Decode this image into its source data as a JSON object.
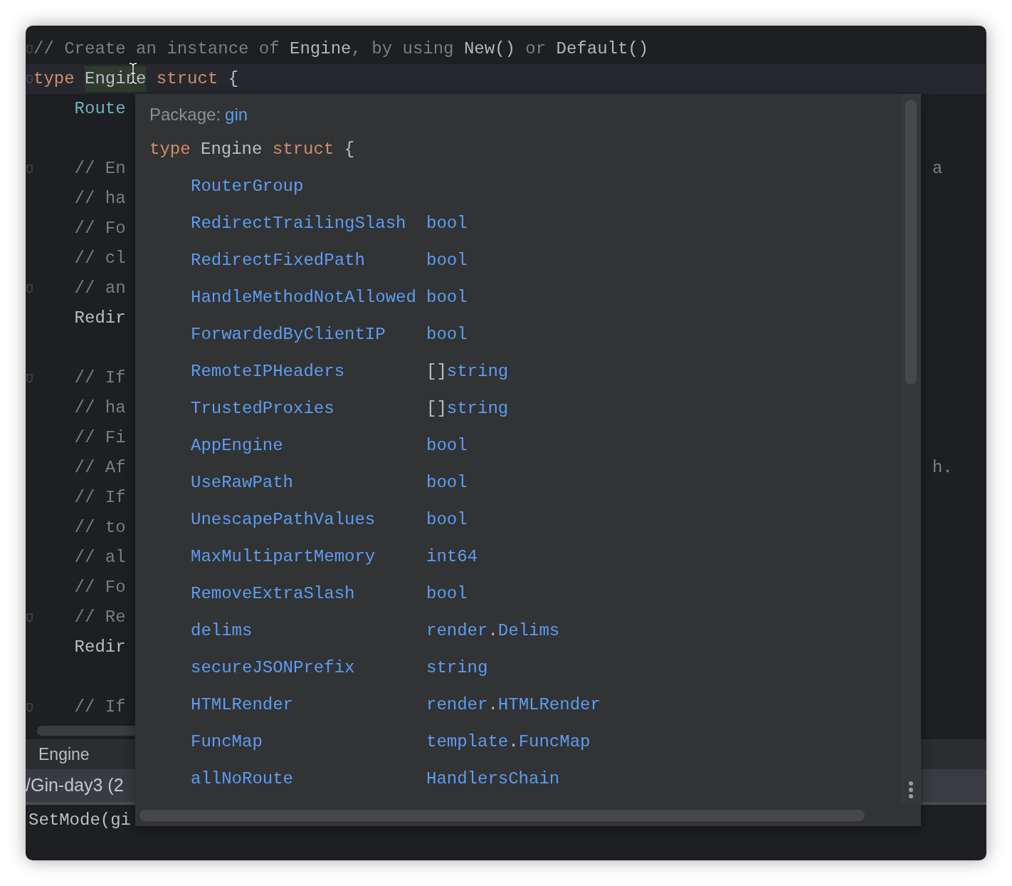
{
  "editor": {
    "lines": [
      {
        "fold": true,
        "current": false,
        "segments": [
          {
            "kind": "comment",
            "text": "// Create an instance of "
          },
          {
            "kind": "comment_ref",
            "text": "Engine"
          },
          {
            "kind": "comment",
            "text": ", by using "
          },
          {
            "kind": "comment_ref",
            "text": "New()"
          },
          {
            "kind": "comment",
            "text": " or "
          },
          {
            "kind": "comment_ref",
            "text": "Default()"
          }
        ]
      },
      {
        "fold": true,
        "current": true,
        "segments": [
          {
            "kind": "keyword",
            "text": "type "
          },
          {
            "kind": "highlight",
            "text": "Engine"
          },
          {
            "kind": "keyword",
            "text": " struct"
          },
          {
            "kind": "plain",
            "text": " {"
          }
        ]
      },
      {
        "fold": false,
        "current": false,
        "segments": [
          {
            "kind": "field",
            "text": "    Route"
          }
        ]
      },
      {
        "fold": false,
        "current": false
      },
      {
        "fold": true,
        "current": false,
        "segments": [
          {
            "kind": "comment",
            "text": "    // En"
          }
        ],
        "tail": "a"
      },
      {
        "fold": false,
        "current": false,
        "segments": [
          {
            "kind": "comment",
            "text": "    // ha"
          }
        ]
      },
      {
        "fold": false,
        "current": false,
        "segments": [
          {
            "kind": "comment",
            "text": "    // Fo"
          }
        ]
      },
      {
        "fold": false,
        "current": false,
        "segments": [
          {
            "kind": "comment",
            "text": "    // cl"
          }
        ]
      },
      {
        "fold": true,
        "current": false,
        "segments": [
          {
            "kind": "comment",
            "text": "    // an"
          }
        ]
      },
      {
        "fold": false,
        "current": false,
        "segments": [
          {
            "kind": "plain",
            "text": "    Redir"
          }
        ]
      },
      {
        "fold": false,
        "current": false
      },
      {
        "fold": true,
        "current": false,
        "segments": [
          {
            "kind": "comment",
            "text": "    // If"
          }
        ]
      },
      {
        "fold": false,
        "current": false,
        "segments": [
          {
            "kind": "comment",
            "text": "    // ha"
          }
        ]
      },
      {
        "fold": false,
        "current": false,
        "segments": [
          {
            "kind": "comment",
            "text": "    // Fi"
          }
        ]
      },
      {
        "fold": false,
        "current": false,
        "segments": [
          {
            "kind": "comment",
            "text": "    // Af"
          }
        ],
        "tail": "h."
      },
      {
        "fold": false,
        "current": false,
        "segments": [
          {
            "kind": "comment",
            "text": "    // If"
          }
        ]
      },
      {
        "fold": false,
        "current": false,
        "segments": [
          {
            "kind": "comment",
            "text": "    // to"
          }
        ]
      },
      {
        "fold": false,
        "current": false,
        "segments": [
          {
            "kind": "comment",
            "text": "    // al"
          }
        ]
      },
      {
        "fold": false,
        "current": false,
        "segments": [
          {
            "kind": "comment",
            "text": "    // Fo"
          }
        ]
      },
      {
        "fold": true,
        "current": false,
        "segments": [
          {
            "kind": "comment",
            "text": "    // Re"
          }
        ]
      },
      {
        "fold": false,
        "current": false,
        "segments": [
          {
            "kind": "plain",
            "text": "    Redir"
          }
        ]
      },
      {
        "fold": false,
        "current": false
      },
      {
        "fold": true,
        "current": false,
        "segments": [
          {
            "kind": "comment",
            "text": "    // If"
          }
        ]
      }
    ]
  },
  "breadcrumb": "Engine",
  "file_tab": "/Gin-day3 (2",
  "bottom_code": "SetMode(gi",
  "popup": {
    "package_label": "Package:",
    "package": "gin",
    "declaration": [
      {
        "kind": "keyword",
        "text": "type"
      },
      {
        "kind": "plain",
        "text": " Engine "
      },
      {
        "kind": "keyword",
        "text": "struct"
      },
      {
        "kind": "plain",
        "text": " {"
      }
    ],
    "fields": [
      {
        "name": "RouterGroup"
      },
      {
        "name": "RedirectTrailingSlash",
        "type": [
          {
            "kind": "name",
            "text": "bool"
          }
        ]
      },
      {
        "name": "RedirectFixedPath",
        "type": [
          {
            "kind": "name",
            "text": "bool"
          }
        ]
      },
      {
        "name": "HandleMethodNotAllowed",
        "type": [
          {
            "kind": "name",
            "text": "bool"
          }
        ]
      },
      {
        "name": "ForwardedByClientIP",
        "type": [
          {
            "kind": "name",
            "text": "bool"
          }
        ]
      },
      {
        "name": "RemoteIPHeaders",
        "type": [
          {
            "kind": "punct",
            "text": "[]"
          },
          {
            "kind": "name",
            "text": "string"
          }
        ]
      },
      {
        "name": "TrustedProxies",
        "type": [
          {
            "kind": "punct",
            "text": "[]"
          },
          {
            "kind": "name",
            "text": "string"
          }
        ]
      },
      {
        "name": "AppEngine",
        "type": [
          {
            "kind": "name",
            "text": "bool"
          }
        ]
      },
      {
        "name": "UseRawPath",
        "type": [
          {
            "kind": "name",
            "text": "bool"
          }
        ]
      },
      {
        "name": "UnescapePathValues",
        "type": [
          {
            "kind": "name",
            "text": "bool"
          }
        ]
      },
      {
        "name": "MaxMultipartMemory",
        "type": [
          {
            "kind": "name",
            "text": "int64"
          }
        ]
      },
      {
        "name": "RemoveExtraSlash",
        "type": [
          {
            "kind": "name",
            "text": "bool"
          }
        ]
      },
      {
        "name": "delims",
        "type": [
          {
            "kind": "name",
            "text": "render"
          },
          {
            "kind": "punct",
            "text": "."
          },
          {
            "kind": "name",
            "text": "Delims"
          }
        ]
      },
      {
        "name": "secureJSONPrefix",
        "type": [
          {
            "kind": "name",
            "text": "string"
          }
        ]
      },
      {
        "name": "HTMLRender",
        "type": [
          {
            "kind": "name",
            "text": "render"
          },
          {
            "kind": "punct",
            "text": "."
          },
          {
            "kind": "name",
            "text": "HTMLRender"
          }
        ]
      },
      {
        "name": "FuncMap",
        "type": [
          {
            "kind": "name",
            "text": "template"
          },
          {
            "kind": "punct",
            "text": "."
          },
          {
            "kind": "name",
            "text": "FuncMap"
          }
        ]
      },
      {
        "name": "allNoRoute",
        "type": [
          {
            "kind": "name",
            "text": "HandlersChain"
          }
        ]
      }
    ]
  }
}
